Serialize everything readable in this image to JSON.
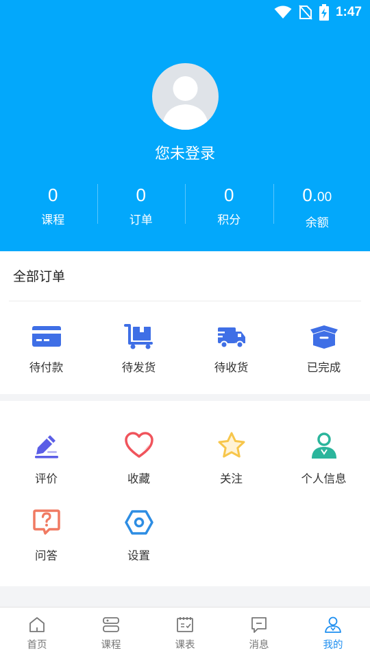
{
  "status_bar": {
    "time": "1:47"
  },
  "profile": {
    "login_text": "您未登录"
  },
  "stats": [
    {
      "value": "0",
      "label": "课程"
    },
    {
      "value": "0",
      "label": "订单"
    },
    {
      "value": "0",
      "label": "积分"
    },
    {
      "value_main": "0.",
      "value_decimal": "00",
      "label": "余额"
    }
  ],
  "orders": {
    "title": "全部订单",
    "items": [
      {
        "label": "待付款",
        "icon": "card-icon"
      },
      {
        "label": "待发货",
        "icon": "cart-box-icon"
      },
      {
        "label": "待收货",
        "icon": "truck-icon"
      },
      {
        "label": "已完成",
        "icon": "box-icon"
      }
    ]
  },
  "tools": {
    "items": [
      {
        "label": "评价",
        "icon": "pen-icon"
      },
      {
        "label": "收藏",
        "icon": "heart-icon"
      },
      {
        "label": "关注",
        "icon": "star-icon"
      },
      {
        "label": "个人信息",
        "icon": "user-info-icon"
      },
      {
        "label": "问答",
        "icon": "question-icon"
      },
      {
        "label": "设置",
        "icon": "settings-hex-icon"
      }
    ]
  },
  "tabbar": {
    "tabs": [
      {
        "label": "首页",
        "icon": "home-icon"
      },
      {
        "label": "课程",
        "icon": "course-icon"
      },
      {
        "label": "课表",
        "icon": "schedule-icon"
      },
      {
        "label": "消息",
        "icon": "message-icon"
      },
      {
        "label": "我的",
        "icon": "profile-icon",
        "active": true
      }
    ]
  },
  "colors": {
    "header_bg": "#03a8fb",
    "order_icon": "#3f6fe6",
    "tab_active": "#1d8ef0",
    "heart": "#f0545c",
    "star": "#f7c64b",
    "user_info": "#2bb59c",
    "question": "#f07a62",
    "settings": "#2d8de3",
    "pen": "#5b5ee6"
  }
}
